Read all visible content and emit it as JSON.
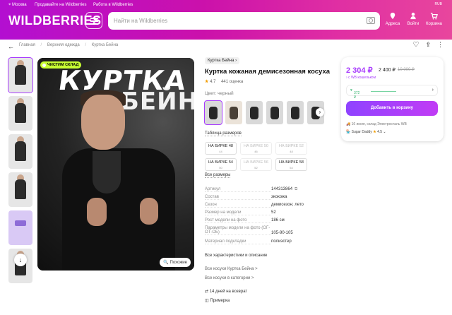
{
  "header": {
    "location": "Москва",
    "seller_link": "Продавайте на Wildberries",
    "jobs_link": "Работа в Wildberries",
    "logo": "WILDBERRIES",
    "search_placeholder": "Найти на Wildberries",
    "icons": [
      {
        "label": "Адреса",
        "icon": "location-icon"
      },
      {
        "label": "Войти",
        "icon": "user-icon"
      },
      {
        "label": "Корзина",
        "icon": "cart-icon"
      }
    ],
    "currency": "RUB"
  },
  "breadcrumbs": [
    "Главная",
    "Верхняя одежда",
    "Куртка Бейна"
  ],
  "photo": {
    "promo": "ЧИСТИМ СКЛАД",
    "headline1": "КУРТКА",
    "headline2": "БЕЙНА",
    "similar_btn": "Похожие"
  },
  "product": {
    "brand": "Куртка Бейна",
    "title": "Куртка кожаная демисезонная косуха",
    "rating": "4.7",
    "reviews": "441 оценка",
    "color_label": "Цвет: черный",
    "size_table": "Таблица размеров",
    "sizes": [
      {
        "label": "НА БИРКЕ 48",
        "sub": "44",
        "available": true
      },
      {
        "label": "НА БИРКЕ 50",
        "sub": "46",
        "available": false
      },
      {
        "label": "НА БИРКЕ 52",
        "sub": "48",
        "available": false
      },
      {
        "label": "НА БИРКЕ 54",
        "sub": "50",
        "available": true
      },
      {
        "label": "НА БИРКЕ 56",
        "sub": "52",
        "available": false
      },
      {
        "label": "НА БИРКЕ 58",
        "sub": "54",
        "available": true
      }
    ],
    "all_sizes": "Все размеры",
    "specs": [
      {
        "k": "Артикул",
        "v": "144313864"
      },
      {
        "k": "Состав",
        "v": "экокожа"
      },
      {
        "k": "Сезон",
        "v": "демисезон; лето"
      },
      {
        "k": "Размер на модели",
        "v": "52"
      },
      {
        "k": "Рост модели на фото",
        "v": "186 см"
      },
      {
        "k": "Параметры модели на фото (ОГ-ОТ-ОБ)",
        "v": "105-90-105"
      },
      {
        "k": "Материал подкладки",
        "v": "полиэстер"
      }
    ],
    "more_specs": "Все характеристики и описание",
    "links": [
      "Все косухи Куртка Бейна >",
      "Все косухи в категории >"
    ],
    "return": "14 дней на возврат",
    "fitting": "Примерка"
  },
  "price": {
    "current": "2 304 ₽",
    "mid": "2 400 ₽",
    "old": "10 000 ₽",
    "wallet_note": "с WB кошельком",
    "credit": "372 ₽",
    "add_to_cart": "Добавить в корзину",
    "delivery": "16 июля, склад Электросталь WB",
    "seller": "Sugar Daddy",
    "seller_rating": "4.5"
  },
  "colors": {
    "accent": "#a73afd",
    "header_start": "#b30fd1",
    "header_end": "#e8469d"
  }
}
